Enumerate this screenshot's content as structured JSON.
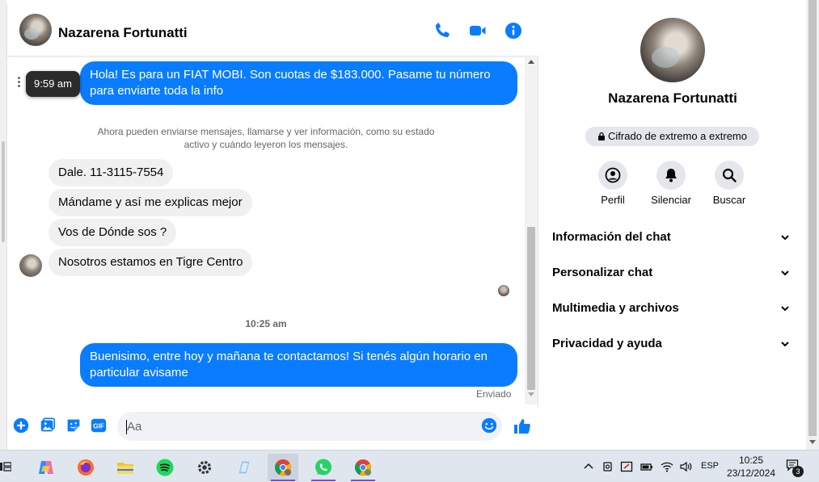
{
  "contact": {
    "name": "Nazarena Fortunatti"
  },
  "messages": {
    "outgoing_1": "Hola! Es para un FIAT MOBI. Son cuotas de $183.000. Pasame tu número para enviarte toda la info",
    "tooltip_time": "9:59 am",
    "system_note": "Ahora pueden enviarse mensajes, llamarse y ver información, como su estado activo y cuándo leyeron los mensajes.",
    "incoming": [
      "Dale.  11-3115-7554",
      "Mándame y así me explicas mejor",
      "Vos de Dónde sos ?",
      "Nosotros estamos en Tigre Centro"
    ],
    "timestamp": "10:25 am",
    "outgoing_2": "Buenisimo, entre hoy y mañana te contactamos! Si tenés algún horario en particular avisame",
    "status": "Enviado"
  },
  "composer": {
    "placeholder": "Aa"
  },
  "panel": {
    "name": "Nazarena Fortunatti",
    "encryption": "Cifrado de extremo a extremo",
    "actions": {
      "profile": "Perfil",
      "mute": "Silenciar",
      "search": "Buscar"
    },
    "sections": {
      "chat_info": "Información del chat",
      "customize": "Personalizar chat",
      "media": "Multimedia y archivos",
      "privacy": "Privacidad y ayuda"
    }
  },
  "taskbar": {
    "apps": [
      "copilot-icon",
      "firefox-icon",
      "file-explorer-icon",
      "spotify-icon",
      "settings-icon",
      "notes-icon",
      "chrome-icon",
      "whatsapp-icon",
      "chrome-icon"
    ],
    "language": "ESP",
    "time": "10:25",
    "date": "23/12/2024",
    "notifications": "3"
  },
  "colors": {
    "messenger_blue": "#0a7cff",
    "incoming_bubble": "#f0f0f0",
    "taskbar": "#dfe6ee"
  }
}
